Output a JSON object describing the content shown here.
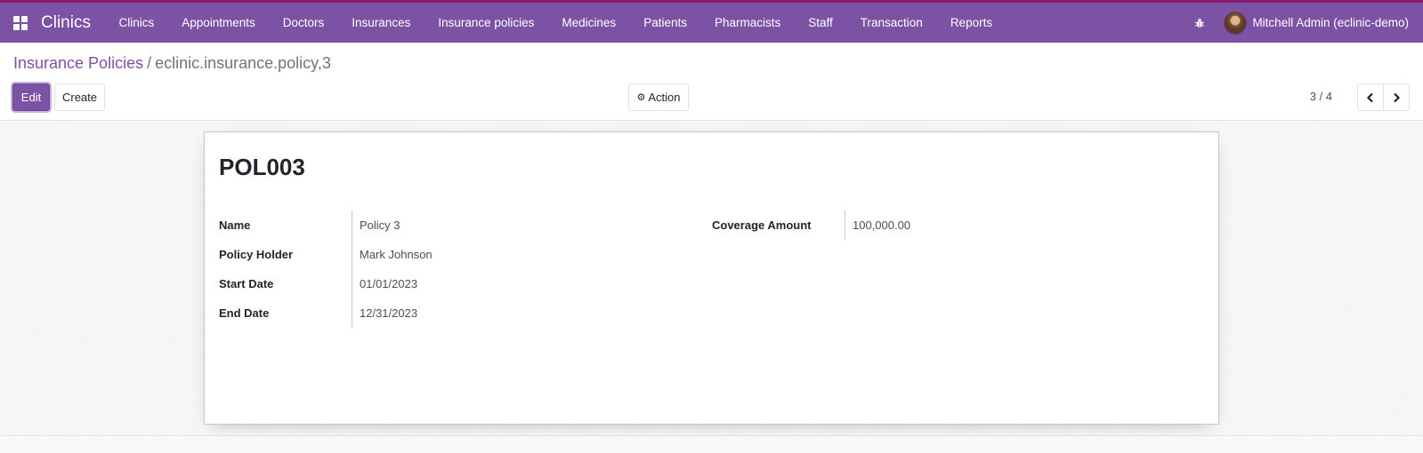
{
  "navbar": {
    "app_name": "Clinics",
    "menu": [
      "Clinics",
      "Appointments",
      "Doctors",
      "Insurances",
      "Insurance policies",
      "Medicines",
      "Patients",
      "Pharmacists",
      "Staff",
      "Transaction",
      "Reports"
    ],
    "user_name": "Mitchell Admin (eclinic-demo)",
    "accent_color": "#7c52a5"
  },
  "breadcrumb": {
    "parent": "Insurance Policies",
    "separator": "/",
    "current": "eclinic.insurance.policy,3"
  },
  "toolbar": {
    "edit_label": "Edit",
    "create_label": "Create",
    "action_label": "Action"
  },
  "pager": {
    "value": "3 / 4"
  },
  "record": {
    "title": "POL003",
    "left_fields": [
      {
        "label": "Name",
        "value": "Policy 3"
      },
      {
        "label": "Policy Holder",
        "value": "Mark Johnson"
      },
      {
        "label": "Start Date",
        "value": "01/01/2023"
      },
      {
        "label": "End Date",
        "value": "12/31/2023"
      }
    ],
    "right_fields": [
      {
        "label": "Coverage Amount",
        "value": "100,000.00"
      }
    ]
  }
}
